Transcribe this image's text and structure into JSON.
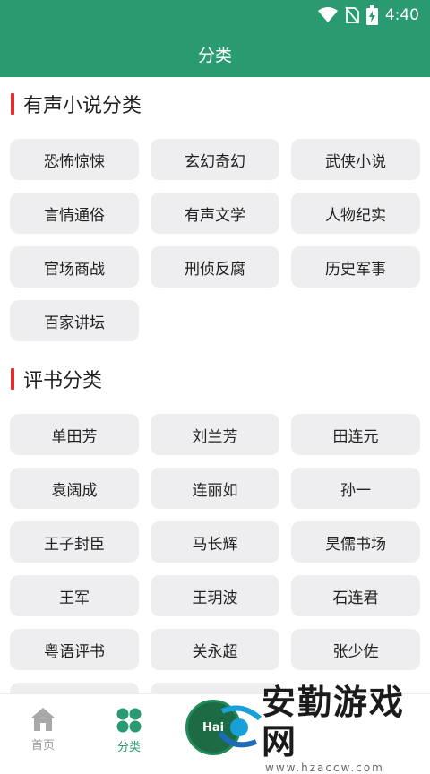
{
  "status_bar": {
    "time": "4:40"
  },
  "header": {
    "title": "分类"
  },
  "sections": [
    {
      "title": "有声小说分类",
      "items": [
        "恐怖惊悚",
        "玄幻奇幻",
        "武侠小说",
        "言情通俗",
        "有声文学",
        "人物纪实",
        "官场商战",
        "刑侦反腐",
        "历史军事",
        "百家讲坛"
      ]
    },
    {
      "title": "评书分类",
      "items": [
        "单田芳",
        "刘兰芳",
        "田连元",
        "袁阔成",
        "连丽如",
        "孙一",
        "王子封臣",
        "马长辉",
        "昊儒书场",
        "王军",
        "王玥波",
        "石连君",
        "粤语评书",
        "关永超",
        "张少佐"
      ]
    }
  ],
  "bottom_nav": {
    "home_label": "首页",
    "category_label": "分类",
    "center_badge": "Hai"
  },
  "watermark": {
    "text": "安勤游戏网",
    "url": "www.hzaccw.com"
  },
  "colors": {
    "primary": "#2a9a70",
    "accent_bar": "#e52b2b",
    "chip_bg": "#eeeef0"
  }
}
